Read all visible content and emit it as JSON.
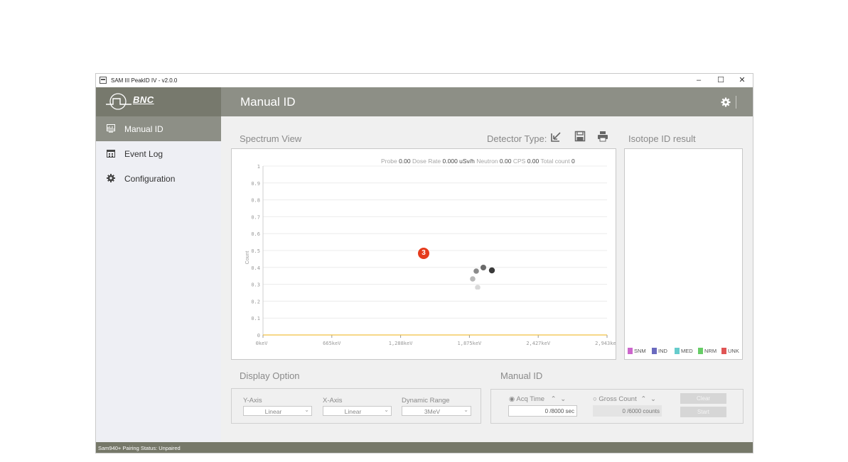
{
  "window": {
    "title": "SAM III PeakID IV - v2.0.0",
    "controls": {
      "minimize": "–",
      "maximize": "☐",
      "close": "✕"
    }
  },
  "brand": {
    "name": "BNC"
  },
  "sidebar": {
    "items": [
      {
        "label": "Manual ID",
        "icon": "spectrum-icon",
        "active": true
      },
      {
        "label": "Event Log",
        "icon": "calendar-icon",
        "active": false
      },
      {
        "label": "Configuration",
        "icon": "gear-icon",
        "active": false
      }
    ]
  },
  "header": {
    "title": "Manual ID"
  },
  "spectrum": {
    "section_label": "Spectrum View",
    "detector_type_label": "Detector Type:",
    "stats": {
      "probe_label": "Probe",
      "probe_value": "0.00",
      "dose_label": "Dose Rate",
      "dose_value": "0.000 uSv/h",
      "neutron_label": "Neutron",
      "neutron_value": "0.00",
      "cps_label": "CPS",
      "cps_value": "0.00",
      "total_label": "Total count",
      "total_value": "0"
    }
  },
  "isotope": {
    "section_label": "Isotope ID result",
    "legend": [
      {
        "label": "SNM",
        "color": "#cc66cc"
      },
      {
        "label": "IND",
        "color": "#6a6abf"
      },
      {
        "label": "MED",
        "color": "#66cccc"
      },
      {
        "label": "NRM",
        "color": "#66cc66"
      },
      {
        "label": "UNK",
        "color": "#e05555"
      }
    ]
  },
  "display_option": {
    "section_label": "Display Option",
    "y_axis": {
      "label": "Y-Axis",
      "value": "Linear"
    },
    "x_axis": {
      "label": "X-Axis",
      "value": "Linear"
    },
    "dynamic_range": {
      "label": "Dynamic Range",
      "value": "3MeV"
    }
  },
  "manual_id": {
    "section_label": "Manual ID",
    "acq_time": {
      "label": "Acq Time",
      "selected": true,
      "value": "0 /8000 sec"
    },
    "gross_count": {
      "label": "Gross Count",
      "selected": false,
      "value": "0 /6000 counts"
    },
    "clear_label": "Clear",
    "start_label": "Start"
  },
  "status_bar": {
    "text": "Sam940+ Pairing Status:  Unpaired"
  },
  "annotation_badge": "3",
  "chart_data": {
    "type": "line",
    "title": "",
    "xlabel": "",
    "ylabel": "Count",
    "x_tick_labels": [
      "0keV",
      "665keV",
      "1,288keV",
      "1,875keV",
      "2,427keV",
      "2,943keV"
    ],
    "y_ticks": [
      0,
      0.1,
      0.2,
      0.3,
      0.4,
      0.5,
      0.6,
      0.7,
      0.8,
      0.9,
      1
    ],
    "ylim": [
      0,
      1
    ],
    "grid": true,
    "series": [
      {
        "color": "#f0c040",
        "values": [
          0,
          0,
          0,
          0,
          0,
          0
        ]
      }
    ]
  }
}
